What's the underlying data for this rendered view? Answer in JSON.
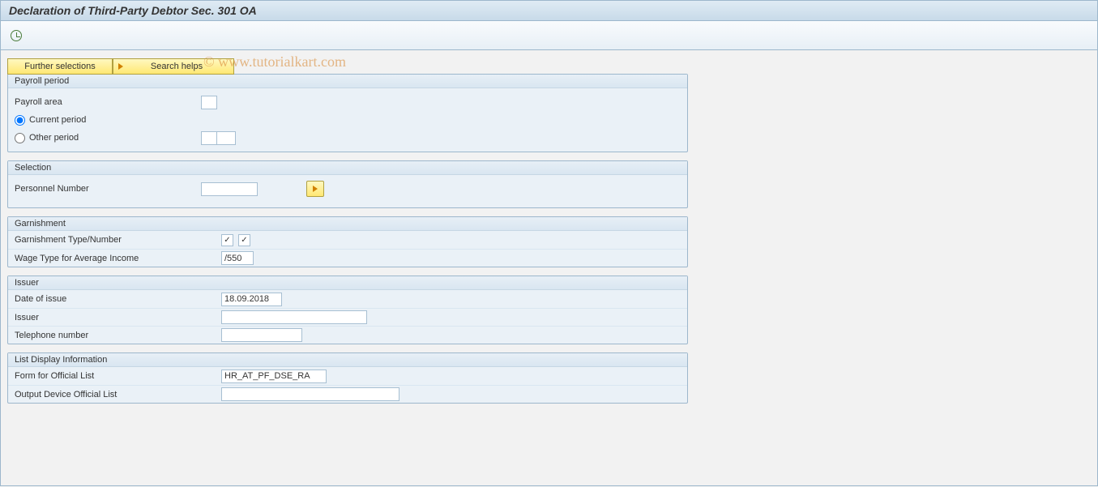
{
  "title": "Declaration of Third-Party Debtor Sec. 301 OA",
  "watermark": "© www.tutorialkart.com",
  "buttons": {
    "further_selections": "Further selections",
    "search_helps": "Search helps"
  },
  "groups": {
    "payroll_period": {
      "title": "Payroll period",
      "payroll_area_label": "Payroll area",
      "payroll_area_value": "",
      "current_period_label": "Current period",
      "other_period_label": "Other period",
      "other_period_val1": "",
      "other_period_val2": ""
    },
    "selection": {
      "title": "Selection",
      "personnel_number_label": "Personnel Number",
      "personnel_number_value": ""
    },
    "garnishment": {
      "title": "Garnishment",
      "type_number_label": "Garnishment Type/Number",
      "wage_type_label": "Wage Type for Average Income",
      "wage_type_value": "/550"
    },
    "issuer": {
      "title": "Issuer",
      "date_label": "Date of issue",
      "date_value": "18.09.2018",
      "issuer_label": "Issuer",
      "issuer_value": "",
      "telephone_label": "Telephone number",
      "telephone_value": ""
    },
    "list_display": {
      "title": "List Display Information",
      "form_label": "Form for Official List",
      "form_value": "HR_AT_PF_DSE_RA",
      "output_label": "Output Device Official List",
      "output_value": ""
    }
  }
}
